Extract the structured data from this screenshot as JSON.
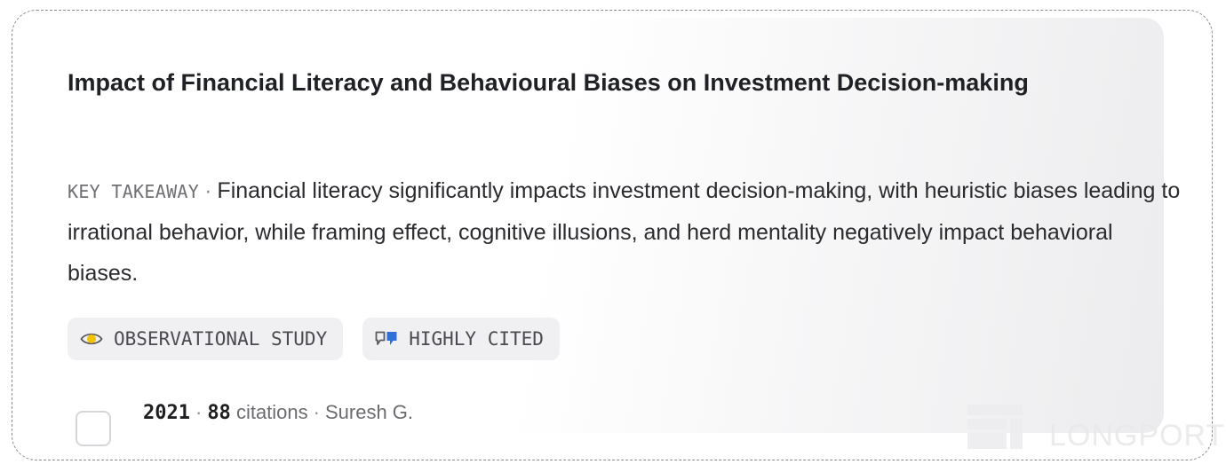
{
  "paper": {
    "title": "Impact of Financial Literacy and Behavioural Biases on Investment Decision-making",
    "takeaway_label": "KEY TAKEAWAY",
    "takeaway_separator": "·",
    "takeaway_text": "Financial literacy significantly impacts investment decision-making, with heuristic biases leading to irrational behavior, while framing effect, cognitive illusions, and herd mentality negatively impact behavioral biases.",
    "tags": [
      {
        "label": "OBSERVATIONAL STUDY",
        "icon": "eye-icon"
      },
      {
        "label": "HIGHLY CITED",
        "icon": "quote-icon"
      }
    ],
    "meta": {
      "year": "2021",
      "citations_count": "88",
      "citations_word": "citations",
      "author": "Suresh G.",
      "separator": "·"
    }
  },
  "watermark": {
    "text": "LONGPORT"
  },
  "colors": {
    "eye_icon": "#f2c200",
    "quote_icon": "#2f6fd6",
    "title": "#202124",
    "tag_background": "#f0f0f2"
  }
}
